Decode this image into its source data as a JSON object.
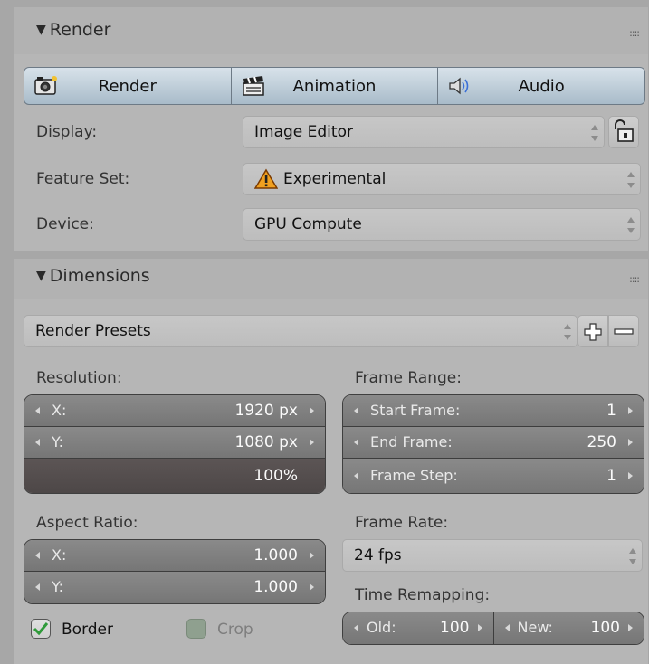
{
  "render_panel": {
    "title": "Render",
    "tabs": [
      {
        "label": "Render",
        "icon": "camera-icon"
      },
      {
        "label": "Animation",
        "icon": "clapperboard-icon"
      },
      {
        "label": "Audio",
        "icon": "speaker-icon"
      }
    ],
    "display": {
      "label": "Display:",
      "value": "Image Editor"
    },
    "feature_set": {
      "label": "Feature Set:",
      "value": "Experimental"
    },
    "device": {
      "label": "Device:",
      "value": "GPU Compute"
    }
  },
  "dimensions_panel": {
    "title": "Dimensions",
    "presets": {
      "value": "Render Presets"
    },
    "resolution": {
      "label": "Resolution:",
      "x": {
        "label": "X:",
        "value": "1920 px"
      },
      "y": {
        "label": "Y:",
        "value": "1080 px"
      },
      "percentage": "100%"
    },
    "frame_range": {
      "label": "Frame Range:",
      "start": {
        "label": "Start Frame:",
        "value": "1"
      },
      "end": {
        "label": "End Frame:",
        "value": "250"
      },
      "step": {
        "label": "Frame Step:",
        "value": "1"
      }
    },
    "aspect_ratio": {
      "label": "Aspect Ratio:",
      "x": {
        "label": "X:",
        "value": "1.000"
      },
      "y": {
        "label": "Y:",
        "value": "1.000"
      }
    },
    "frame_rate": {
      "label": "Frame Rate:",
      "value": "24 fps"
    },
    "time_remapping": {
      "label": "Time Remapping:",
      "old": {
        "label": "Old:",
        "value": "100"
      },
      "new": {
        "label": "New:",
        "value": "100"
      }
    },
    "border": {
      "label": "Border",
      "checked": true
    },
    "crop": {
      "label": "Crop",
      "checked": false
    }
  },
  "colors": {
    "tab_accent": "#a8bbc9",
    "warning": "#f0a020",
    "check": "#2f9a3a"
  }
}
